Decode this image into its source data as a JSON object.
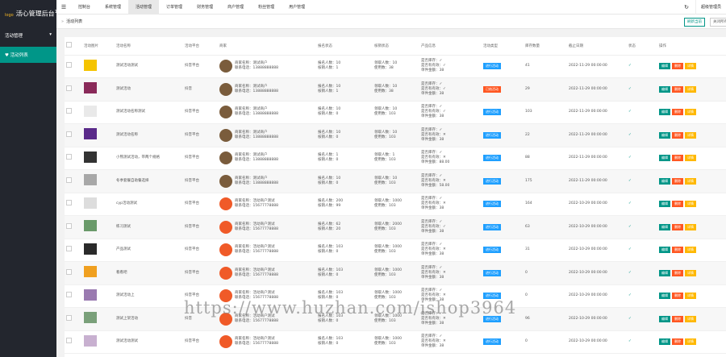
{
  "app": {
    "logo_text": "logo",
    "title": "活心管理后台",
    "version": "1.3"
  },
  "sidebar": {
    "group_label": "活动管理",
    "group_arrow": "▾",
    "item_label": "活动列表",
    "item_icon": "♥"
  },
  "topnav": {
    "menu_icon": "☰",
    "items": [
      {
        "label": "控制台"
      },
      {
        "label": "系统管理"
      },
      {
        "label": "活动管理"
      },
      {
        "label": "订单管理"
      },
      {
        "label": "财务管理"
      },
      {
        "label": "商户管理"
      },
      {
        "label": "粉丝管理"
      },
      {
        "label": "用户管理"
      }
    ],
    "active_index": 2,
    "refresh_icon": "↻",
    "user_label": "超级管理员"
  },
  "tabs": {
    "crumb": "活动列表",
    "btn1": "刷新当前",
    "btn2": "关闭所有"
  },
  "table": {
    "headers": [
      "",
      "活动图片",
      "活动名称",
      "活动平台",
      "商家",
      "报名状态",
      "核销状态",
      "产品信息",
      "活动类型",
      "库存数量",
      "截止日期",
      "状态",
      "操作"
    ],
    "rows": [
      {
        "thumb": "#f5c400",
        "name": "测试活动测试",
        "platform": "抖音平台",
        "avatar": "#7a5c3c",
        "m1": "商家名称：测试商户",
        "m2": "联系电话：13888888888",
        "s1": "报名人数：10",
        "s2": "核销人数：1",
        "h1": "领取人数：10",
        "h2": "使用数：38",
        "p1": "是否库存：✓",
        "p2": "是否有有效：✓",
        "p3": "单件金额：38",
        "type": "进行活动",
        "type_color": "#1e9fff",
        "stock": "41",
        "date": "2022-11-29 00:00:00",
        "status": "✓"
      },
      {
        "thumb": "#8a2a5a",
        "name": "测试活动",
        "platform": "抖音",
        "avatar": "#7a5c3c",
        "m1": "商家名称：测试商户",
        "m2": "联系电话：13888888888",
        "s1": "报名人数：10",
        "s2": "核销人数：1",
        "h1": "领取人数：10",
        "h2": "使用数：38",
        "p1": "是否库存：✓",
        "p2": "是否有有效：✓",
        "p3": "单件金额：38",
        "type": "已结活动",
        "type_color": "#ff5722",
        "stock": "29",
        "date": "2022-11-29 00:00:00",
        "status": "✓"
      },
      {
        "thumb": "#e9e9e9",
        "name": "测试活动名称测试",
        "platform": "抖音平台",
        "avatar": "#7a5c3c",
        "m1": "商家名称：测试商户",
        "m2": "联系电话：13888888888",
        "s1": "报名人数：10",
        "s2": "核销人数：0",
        "h1": "领取人数：10",
        "h2": "使用数：103",
        "p1": "是否库存：✓",
        "p2": "是否有有效：✓",
        "p3": "单件金额：38",
        "type": "进行活动",
        "type_color": "#1e9fff",
        "stock": "103",
        "date": "2022-11-29 00:00:00",
        "status": "✓"
      },
      {
        "thumb": "#5a2a8a",
        "name": "测试活动名称",
        "platform": "抖音平台",
        "avatar": "#7a5c3c",
        "m1": "商家名称：测试商户",
        "m2": "联系电话：13888888888",
        "s1": "报名人数：10",
        "s2": "核销人数：0",
        "h1": "领取人数：10",
        "h2": "使用数：103",
        "p1": "是否库存：✓",
        "p2": "是否有有效：✕",
        "p3": "单件金额：38",
        "type": "进行活动",
        "type_color": "#1e9fff",
        "stock": "22",
        "date": "2022-11-29 00:00:00",
        "status": "✓"
      },
      {
        "thumb": "#333333",
        "name": "小熊测试活动，带两个规格",
        "platform": "抖音平台",
        "avatar": "#7a5c3c",
        "m1": "商家名称：测试商户",
        "m2": "联系电话：13888888888",
        "s1": "报名人数：1",
        "s2": "核销人数：0",
        "h1": "领取人数：1",
        "h2": "使用数：103",
        "p1": "是否库存：✓",
        "p2": "是否有有效：✕",
        "p3": "单件金额：88.00",
        "type": "进行活动",
        "type_color": "#1e9fff",
        "stock": "88",
        "date": "2022-11-29 00:00:00",
        "status": "✓"
      },
      {
        "thumb": "#a8a8a8",
        "name": "冬季套餐自助餐选择",
        "platform": "抖音平台",
        "avatar": "#7a5c3c",
        "m1": "商家名称：测试商户",
        "m2": "联系电话：13888888888",
        "s1": "报名人数：10",
        "s2": "核销人数：0",
        "h1": "领取人数：10",
        "h2": "使用数：103",
        "p1": "是否库存：✓",
        "p2": "是否有有效：✕",
        "p3": "单件金额：58.00",
        "type": "进行活动",
        "type_color": "#1e9fff",
        "stock": "175",
        "date": "2022-11-29 00:00:00",
        "status": "✓"
      },
      {
        "thumb": "#dddddd",
        "name": "cyp活动测试",
        "platform": "抖音平台",
        "avatar": "#f05a28",
        "m1": "商家名称：活动商户测试",
        "m2": "联系电话：15677778888",
        "s1": "报名人数：200",
        "s2": "核销人数：99",
        "h1": "领取人数：1000",
        "h2": "使用数：103",
        "p1": "是否库存：✓",
        "p2": "是否有有效：✕",
        "p3": "单件金额：38",
        "type": "进行活动",
        "type_color": "#1e9fff",
        "stock": "164",
        "date": "2022-10-29 00:00:00",
        "status": "✓"
      },
      {
        "thumb": "#6a9a6a",
        "name": "练习测试",
        "platform": "抖音平台",
        "avatar": "#f05a28",
        "m1": "商家名称：活动商户测试",
        "m2": "联系电话：15677778888",
        "s1": "报名人数：62",
        "s2": "核销人数：20",
        "h1": "领取人数：2000",
        "h2": "使用数：103",
        "p1": "是否库存：✓",
        "p2": "是否有有效：✓",
        "p3": "单件金额：38",
        "type": "进行活动",
        "type_color": "#1e9fff",
        "stock": "63",
        "date": "2022-10-29 00:00:00",
        "status": "✓"
      },
      {
        "thumb": "#2a2a2a",
        "name": "产品测试",
        "platform": "抖音平台",
        "avatar": "#f05a28",
        "m1": "商家名称：活动商户测试",
        "m2": "联系电话：15677778888",
        "s1": "报名人数：103",
        "s2": "核销人数：0",
        "h1": "领取人数：1000",
        "h2": "使用数：103",
        "p1": "是否库存：✓",
        "p2": "是否有有效：✕",
        "p3": "单件金额：38",
        "type": "进行活动",
        "type_color": "#1e9fff",
        "stock": "31",
        "date": "2022-10-29 00:00:00",
        "status": "✓"
      },
      {
        "thumb": "#f0a020",
        "name": "看看吧",
        "platform": "抖音平台",
        "avatar": "#f05a28",
        "m1": "商家名称：活动商户测试",
        "m2": "联系电话：15677778888",
        "s1": "报名人数：103",
        "s2": "核销人数：0",
        "h1": "领取人数：1000",
        "h2": "使用数：103",
        "p1": "是否库存：✓",
        "p2": "是否有有效：✕",
        "p3": "单件金额：38",
        "type": "进行活动",
        "type_color": "#1e9fff",
        "stock": "0",
        "date": "2022-10-29 00:00:00",
        "status": "✓"
      },
      {
        "thumb": "#9a7ab0",
        "name": "测试活动上",
        "platform": "抖音平台",
        "avatar": "#f05a28",
        "m1": "商家名称：活动商户测试",
        "m2": "联系电话：15677778888",
        "s1": "报名人数：103",
        "s2": "核销人数：0",
        "h1": "领取人数：1000",
        "h2": "使用数：103",
        "p1": "是否库存：✓",
        "p2": "是否有有效：✕",
        "p3": "单件金额：38",
        "type": "进行活动",
        "type_color": "#1e9fff",
        "stock": "0",
        "date": "2022-10-29 00:00:00",
        "status": "✓"
      },
      {
        "thumb": "#7aa07a",
        "name": "测试上架活动",
        "platform": "抖音",
        "avatar": "#f05a28",
        "m1": "商家名称：活动商户测试",
        "m2": "联系电话：15677778888",
        "s1": "报名人数：103",
        "s2": "核销人数：0",
        "h1": "领取人数：1000",
        "h2": "使用数：103",
        "p1": "是否库存：✓",
        "p2": "是否有有效：✕",
        "p3": "单件金额：38",
        "type": "进行活动",
        "type_color": "#1e9fff",
        "stock": "96",
        "date": "2022-10-29 00:00:00",
        "status": "✓"
      },
      {
        "thumb": "#c8b0d0",
        "name": "测试活动测试",
        "platform": "抖音平台",
        "avatar": "#f05a28",
        "m1": "商家名称：活动商户测试",
        "m2": "联系电话：15677778888",
        "s1": "报名人数：103",
        "s2": "核销人数：0",
        "h1": "领取人数：1000",
        "h2": "使用数：103",
        "p1": "是否库存：✓",
        "p2": "是否有有效：✕",
        "p3": "单件金额：38",
        "type": "进行活动",
        "type_color": "#1e9fff",
        "stock": "0",
        "date": "2022-10-29 00:00:00",
        "status": "✓"
      }
    ],
    "actions": {
      "edit": "编辑",
      "delete": "删除",
      "more": "详情"
    }
  },
  "watermark": "https://www.huzhan.com/ishop3964"
}
